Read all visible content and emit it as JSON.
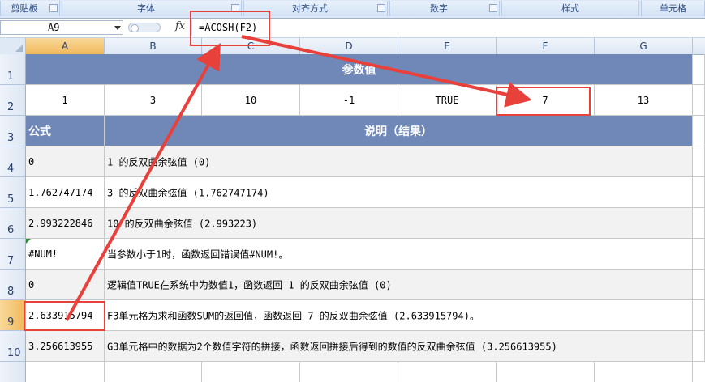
{
  "ribbon": {
    "groups": [
      {
        "label": "剪贴板"
      },
      {
        "label": "字体"
      },
      {
        "label": "对齐方式"
      },
      {
        "label": "数字"
      },
      {
        "label": "样式"
      },
      {
        "label": "单元格"
      }
    ]
  },
  "formula_bar": {
    "name_box": "A9",
    "fx_symbol": "fx",
    "formula": "=ACOSH(F2)"
  },
  "columns": [
    "A",
    "B",
    "C",
    "D",
    "E",
    "F",
    "G"
  ],
  "rows": [
    "1",
    "2",
    "3",
    "4",
    "5",
    "6",
    "7",
    "8",
    "9",
    "10"
  ],
  "sheet": {
    "param_title": "参数值",
    "params": [
      "1",
      "3",
      "10",
      "-1",
      "TRUE",
      "7",
      "13"
    ],
    "formula_header": "公式",
    "desc_header": "说明（结果）",
    "results": [
      {
        "value": "0",
        "desc": "1 的反双曲余弦值 (0)"
      },
      {
        "value": "1.762747174",
        "desc": "3 的反双曲余弦值 (1.762747174)"
      },
      {
        "value": "2.993222846",
        "desc": "10 的反双曲余弦值 (2.993223)"
      },
      {
        "value": "#NUM!",
        "desc": "当参数小于1时，函数返回错误值#NUM!。"
      },
      {
        "value": "0",
        "desc": "逻辑值TRUE在系统中为数值1，函数返回 1 的反双曲余弦值 (0)"
      },
      {
        "value": "2.633915794",
        "desc": "F3单元格为求和函数SUM的返回值，函数返回 7 的反双曲余弦值 (2.633915794)。"
      },
      {
        "value": "3.256613955",
        "desc": "G3单元格中的数据为2个数值字符的拼接，函数返回拼接后得到的数值的反双曲余弦值 (3.256613955)"
      }
    ]
  },
  "colors": {
    "header_blue": "#6f88b8",
    "annotation_red": "#e8413b",
    "selected_header": "#f1b85b"
  }
}
